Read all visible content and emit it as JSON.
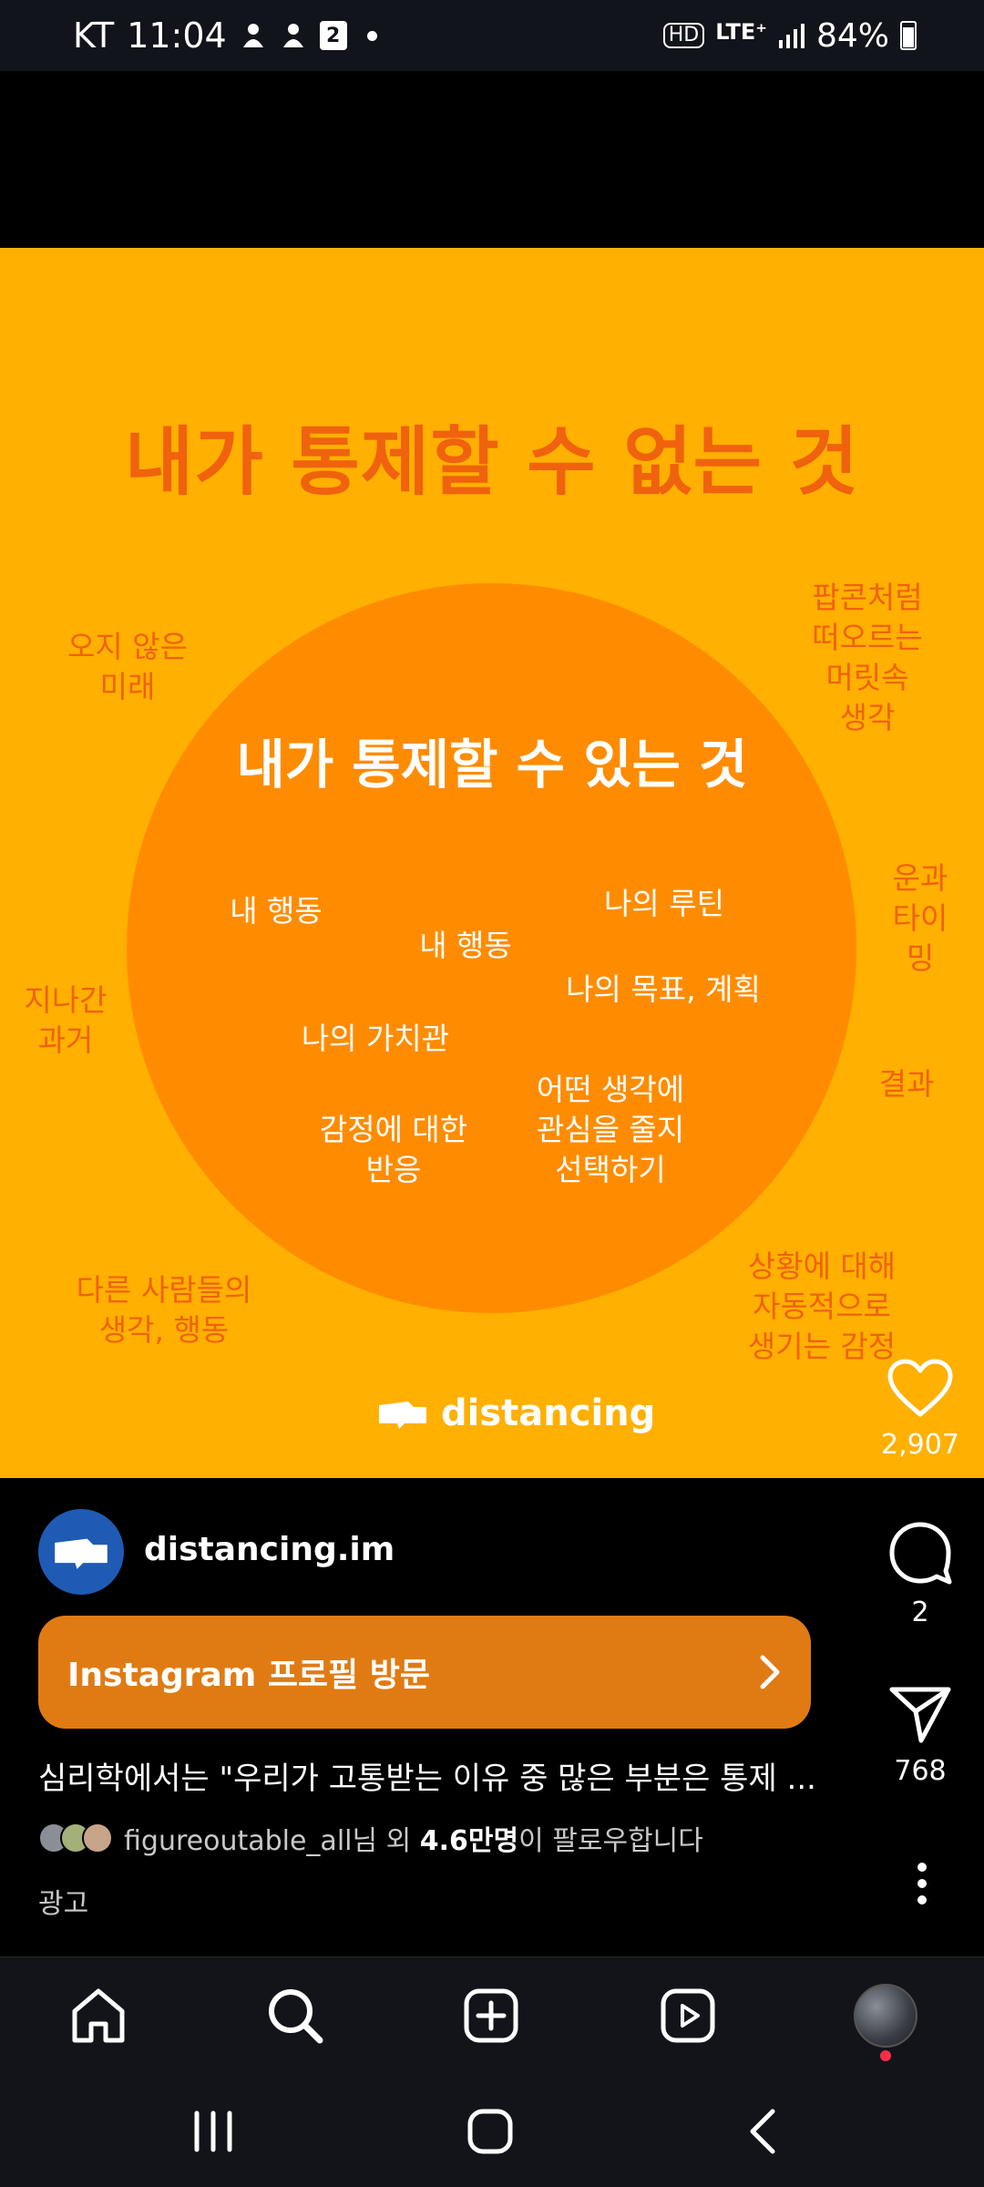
{
  "status_bar": {
    "carrier": "KT",
    "time": "11:04",
    "notification_icons": [
      "app-icon",
      "app-icon",
      "calendar-icon"
    ],
    "calendar_day": "2",
    "hd_badge": "HD",
    "network": "LTE⁺",
    "battery": "84%"
  },
  "post": {
    "image": {
      "outer_title": "내가 통제할 수 없는 것",
      "inner_title": "내가 통제할 수 있는 것",
      "inner_items": [
        "내 행동",
        "내 행동",
        "나의 루틴",
        "나의 목표, 계획",
        "나의 가치관",
        "어떤 생각에\n관심을 줄지\n선택하기",
        "감정에 대한\n반응"
      ],
      "outer_items": [
        "오지 않은\n미래",
        "팝콘처럼\n떠오르는\n머릿속 생각",
        "운과\n타이밍",
        "지나간\n과거",
        "결과",
        "다른 사람들의\n생각, 행동",
        "상황에 대해\n자동적으로\n생기는 감정"
      ],
      "brand": "distancing",
      "colors": {
        "background": "#ffb000",
        "circle": "#ff8c00",
        "outer_text": "#f0620e"
      }
    },
    "actions": {
      "likes": "2,907",
      "comments": "2",
      "shares": "768"
    },
    "author": "distancing.im",
    "cta_label": "Instagram 프로필 방문",
    "caption": "심리학에서는 \"우리가 고통받는 이유 중 많은 부분은 통제 ...",
    "followers": {
      "name": "figureoutable_all",
      "text_mid": "님 외 ",
      "count": "4.6만명",
      "text_end": "이 팔로우합니다"
    },
    "ad_label": "광고"
  },
  "bottom_nav": {
    "items": [
      "home-icon",
      "search-icon",
      "create-icon",
      "reels-icon",
      "profile-avatar"
    ]
  }
}
